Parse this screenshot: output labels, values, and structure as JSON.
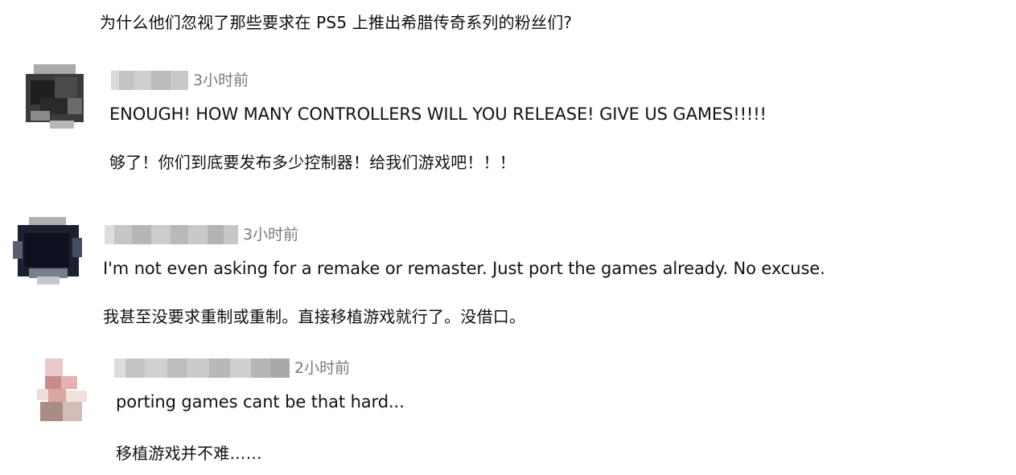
{
  "top_translation": "为什么他们忽视了那些要求在 PS5 上推出希腊传奇系列的粉丝们?",
  "comments": [
    {
      "timestamp": "3小时前",
      "text": "ENOUGH! HOW MANY CONTROLLERS WILL YOU RELEASE! GIVE US GAMES!!!!!",
      "translation": "够了！你们到底要发布多少控制器！给我们游戏吧！！！"
    },
    {
      "timestamp": "3小时前",
      "text": "I'm not even asking for a remake or remaster.  Just port the games already.  No excuse.",
      "translation": "我甚至没要求重制或重制。直接移植游戏就行了。没借口。"
    },
    {
      "timestamp": "2小时前",
      "text": "porting games cant be that hard...",
      "translation": "移植游戏并不难……"
    }
  ]
}
